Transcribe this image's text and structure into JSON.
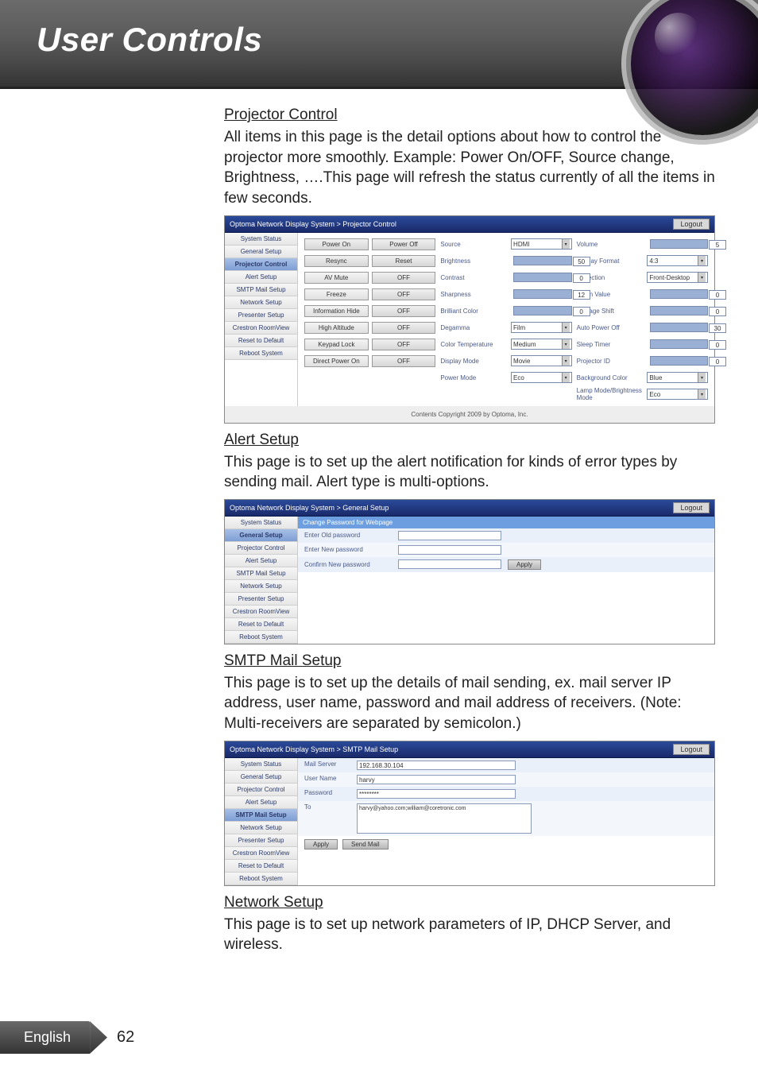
{
  "header": {
    "title": "User Controls"
  },
  "sections": {
    "projector_control": {
      "heading": "Projector Control",
      "body": "All items in this page is the detail options about how to control the projector more smoothly. Example: Power On/OFF, Source change, Brightness, ….This page will refresh the status currently of all the items in few seconds."
    },
    "alert_setup": {
      "heading": "Alert Setup",
      "body": "This page is to set up the alert notification for kinds of error types by sending mail. Alert type is multi-options."
    },
    "smtp_mail_setup": {
      "heading": "SMTP Mail Setup",
      "body": "This page is to set up the details of mail sending, ex. mail server IP address, user name, password and mail address of receivers. (Note: Multi-receivers are separated by semicolon.)"
    },
    "network_setup": {
      "heading": "Network Setup",
      "body": "This page is to set up network parameters of IP, DHCP Server, and wireless."
    }
  },
  "shot_common": {
    "logout": "Logout",
    "copyright": "Contents Copyright 2009 by Optoma, Inc."
  },
  "side_nav": {
    "items": [
      "System Status",
      "General Setup",
      "Projector Control",
      "Alert Setup",
      "SMTP Mail Setup",
      "Network Setup",
      "Presenter Setup",
      "Crestron RoomView",
      "Reset to Default",
      "Reboot System"
    ]
  },
  "projector_shot": {
    "title": "Optoma Network Display System > Projector Control",
    "col1": {
      "power_on": "Power On",
      "power_off": "Power Off",
      "resync": "Resync",
      "reset": "Reset",
      "av_mute": "AV Mute",
      "av_mute_state": "OFF",
      "freeze": "Freeze",
      "freeze_state": "OFF",
      "info_hide": "Information Hide",
      "info_hide_state": "OFF",
      "high_alt": "High Altitude",
      "high_alt_state": "OFF",
      "keypad": "Keypad Lock",
      "keypad_state": "OFF",
      "direct_power": "Direct Power On",
      "direct_power_state": "OFF"
    },
    "col2": {
      "source": "Source",
      "source_val": "HDMI",
      "brightness": "Brightness",
      "brightness_val": "50",
      "contrast": "Contrast",
      "contrast_val": "0",
      "sharpness": "Sharpness",
      "sharpness_val": "12",
      "brilliant": "Brilliant Color",
      "brilliant_val": "0",
      "degamma": "Degamma",
      "degamma_val": "Film",
      "color_temp": "Color Temperature",
      "color_temp_val": "Medium",
      "display_mode": "Display Mode",
      "display_mode_val": "Movie",
      "power_mode": "Power Mode",
      "power_mode_val": "Eco"
    },
    "col3": {
      "volume": "Volume",
      "volume_val": "5",
      "disp_format": "Display Format",
      "disp_format_val": "4:3",
      "projection": "Projection",
      "projection_val": "Front-Desktop",
      "zoom": "Zoom Value",
      "zoom_val": "0",
      "vshift": "V.Image Shift",
      "vshift_val": "0",
      "auto_off": "Auto Power Off",
      "auto_off_val": "30",
      "sleep": "Sleep Timer",
      "sleep_val": "0",
      "proj_id": "Projector ID",
      "proj_id_val": "0",
      "bg": "Background Color",
      "bg_val": "Blue",
      "lamp": "Lamp Mode/Brightness Mode",
      "lamp_val": "Eco"
    }
  },
  "alert_shot": {
    "title": "Optoma Network Display System > General Setup",
    "panel_header": "Change Password for Webpage",
    "old_pw": "Enter Old password",
    "new_pw": "Enter New password",
    "confirm_pw": "Confirm New password",
    "apply": "Apply"
  },
  "smtp_shot": {
    "title": "Optoma Network Display System > SMTP Mail Setup",
    "mail_server": "Mail Server",
    "mail_server_val": "192.168.30.104",
    "user_name": "User Name",
    "user_name_val": "harvy",
    "password": "Password",
    "password_val": "********",
    "to": "To",
    "to_val": "harvy@yahoo.com;william@coretronic.com",
    "apply": "Apply",
    "send_mail": "Send Mail"
  },
  "footer": {
    "lang": "English",
    "page": "62"
  }
}
